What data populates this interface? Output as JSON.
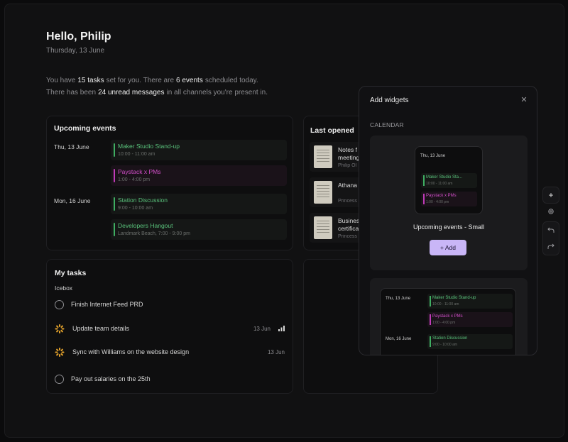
{
  "header": {
    "greeting": "Hello, Philip",
    "date": "Thursday, 13 June"
  },
  "summary": {
    "line1_a": "You have",
    "tasks": "15 tasks",
    "line1_b": "set for you. There are",
    "events": "6 events",
    "line1_c": "scheduled today.",
    "line2_a": "There has been",
    "messages": "24 unread messages",
    "line2_b": "in all channels you're present in."
  },
  "upcoming": {
    "title": "Upcoming events",
    "days": [
      {
        "label": "Thu, 13 June",
        "events": [
          {
            "title": "Maker Studio Stand-up",
            "sub": "10:00 - 11:00 am",
            "color": "green"
          },
          {
            "title": "Paystack x PMs",
            "sub": "1:00 - 4:00 pm",
            "color": "pink"
          }
        ]
      },
      {
        "label": "Mon, 16 June",
        "events": [
          {
            "title": "Station Discussion",
            "sub": "9:00 - 10:00 am",
            "color": "green"
          },
          {
            "title": "Developers Hangout",
            "sub": "Landmark Beach, 7:00 - 9:00 pm",
            "color": "green"
          }
        ]
      }
    ]
  },
  "last_opened": {
    "title": "Last opened",
    "docs": [
      {
        "name1": "Notes f",
        "name2": "meeting",
        "owner": "Philip Ol"
      },
      {
        "name1": "Athana",
        "name2": "",
        "owner": "Princess"
      },
      {
        "name1": "Busines",
        "name2": "certifica",
        "owner": "Princess"
      }
    ]
  },
  "tasks": {
    "title": "My tasks",
    "group": "Icebox",
    "items": [
      {
        "label": "Finish Internet Feed PRD",
        "status": "todo",
        "due": ""
      },
      {
        "label": "Update team details",
        "status": "in-progress",
        "due": "13 Jun",
        "priority_icon": "signal-bars-icon"
      },
      {
        "label": "Sync with Williams on the website design",
        "status": "in-progress",
        "due": "13 Jun"
      },
      {
        "label": "Pay out salaries on the 25th",
        "status": "todo",
        "due": ""
      }
    ]
  },
  "widgets_panel": {
    "title": "Add widgets",
    "close_icon": "close-icon",
    "section": "CALENDAR",
    "small_widget": {
      "day": "Thu, 13 June",
      "events": [
        {
          "title": "Maker Studio Sta...",
          "sub": "10:00 - 11:00 am",
          "color": "green"
        },
        {
          "title": "Paystack x PMs",
          "sub": "1:00 - 4:00 pm",
          "color": "pink"
        }
      ],
      "name": "Upcoming events - Small",
      "add_label": "+ Add"
    },
    "large_widget": {
      "days": [
        {
          "label": "Thu, 13 June",
          "events": [
            {
              "title": "Maker Studio Stand-up",
              "sub": "10:00 - 11:00 am",
              "color": "green"
            },
            {
              "title": "Paystack x PMs",
              "sub": "1:00 - 4:00 pm",
              "color": "pink"
            }
          ]
        },
        {
          "label": "Mon, 16 June",
          "events": [
            {
              "title": "Station Discussion",
              "sub": "9:00 - 10:00 am",
              "color": "green"
            }
          ]
        }
      ]
    }
  },
  "toolbar": {
    "add": "+",
    "settings_icon": "gear-icon",
    "undo_icon": "undo-icon",
    "redo_icon": "redo-icon"
  },
  "colors": {
    "accent_green": "#59c27b",
    "accent_pink": "#d44fcb",
    "add_button": "#c9b6f7",
    "progress": "#e2a12b"
  }
}
